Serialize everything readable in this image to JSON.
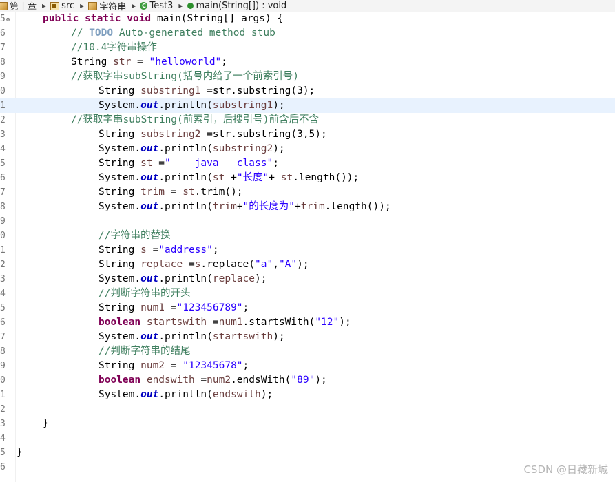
{
  "breadcrumb": {
    "items": [
      {
        "label": "第十章",
        "icon": "package-folder-icon"
      },
      {
        "label": "src",
        "icon": "source-folder-icon"
      },
      {
        "label": "字符串",
        "icon": "package-icon"
      },
      {
        "label": "Test3",
        "icon": "java-class-icon"
      },
      {
        "label": "main(String[]) : void",
        "icon": "public-method-icon"
      }
    ]
  },
  "editor": {
    "current_line": "1",
    "lines": [
      {
        "num": "5",
        "fold": "⊖",
        "tokens": [
          [
            "kw",
            "public static void "
          ],
          [
            "",
            "main(String[] args) {"
          ]
        ]
      },
      {
        "num": "6",
        "tokens": [
          [
            "cm",
            "// "
          ],
          [
            "todo",
            "TODO"
          ],
          [
            "cm",
            " Auto-generated method stub"
          ]
        ]
      },
      {
        "num": "7",
        "tokens": [
          [
            "cm",
            "//10.4字符串操作"
          ]
        ]
      },
      {
        "num": "8",
        "tokens": [
          [
            "",
            "String "
          ],
          [
            "var",
            "str"
          ],
          [
            "",
            " = "
          ],
          [
            "str",
            "\"helloworld\""
          ],
          [
            "",
            ";"
          ]
        ]
      },
      {
        "num": "9",
        "tokens": [
          [
            "cm",
            "//获取字串subString(括号内给了一个前索引号)"
          ]
        ]
      },
      {
        "num": "0",
        "tokens": [
          [
            "",
            "String "
          ],
          [
            "var",
            "substring1"
          ],
          [
            "",
            " =str.substring(3);"
          ]
        ]
      },
      {
        "num": "1",
        "tokens": [
          [
            "",
            "System."
          ],
          [
            "fld",
            "out"
          ],
          [
            "",
            ".println("
          ],
          [
            "var",
            "substring1"
          ],
          [
            "",
            ");"
          ]
        ]
      },
      {
        "num": "2",
        "tokens": [
          [
            "cm",
            "//获取字串subString(前索引，后搜引号)前含后不含"
          ]
        ]
      },
      {
        "num": "3",
        "tokens": [
          [
            "",
            "String "
          ],
          [
            "var",
            "substring2"
          ],
          [
            "",
            " =str.substring(3,5);"
          ]
        ]
      },
      {
        "num": "4",
        "tokens": [
          [
            "",
            "System."
          ],
          [
            "fld",
            "out"
          ],
          [
            "",
            ".println("
          ],
          [
            "var",
            "substring2"
          ],
          [
            "",
            ");"
          ]
        ]
      },
      {
        "num": "5",
        "tokens": [
          [
            "",
            "String "
          ],
          [
            "var",
            "st"
          ],
          [
            "",
            " ="
          ],
          [
            "str",
            "\"    java   class\""
          ],
          [
            "",
            ";"
          ]
        ]
      },
      {
        "num": "6",
        "tokens": [
          [
            "",
            "System."
          ],
          [
            "fld",
            "out"
          ],
          [
            "",
            ".println("
          ],
          [
            "var",
            "st"
          ],
          [
            "",
            " +"
          ],
          [
            "str",
            "\"长度\""
          ],
          [
            "",
            "+ "
          ],
          [
            "var",
            "st"
          ],
          [
            "",
            ".length());"
          ]
        ]
      },
      {
        "num": "7",
        "tokens": [
          [
            "",
            "String "
          ],
          [
            "var",
            "trim"
          ],
          [
            "",
            " = "
          ],
          [
            "var",
            "st"
          ],
          [
            "",
            ".trim();"
          ]
        ]
      },
      {
        "num": "8",
        "tokens": [
          [
            "",
            "System."
          ],
          [
            "fld",
            "out"
          ],
          [
            "",
            ".println("
          ],
          [
            "var",
            "trim"
          ],
          [
            "",
            "+"
          ],
          [
            "str",
            "\"的长度为\""
          ],
          [
            "",
            "+"
          ],
          [
            "var",
            "trim"
          ],
          [
            "",
            ".length());"
          ]
        ]
      },
      {
        "num": "9",
        "tokens": []
      },
      {
        "num": "0",
        "tokens": [
          [
            "cm",
            "//字符串的替换"
          ]
        ]
      },
      {
        "num": "1",
        "tokens": [
          [
            "",
            "String "
          ],
          [
            "var",
            "s"
          ],
          [
            "",
            " ="
          ],
          [
            "str",
            "\"address\""
          ],
          [
            "",
            ";"
          ]
        ]
      },
      {
        "num": "2",
        "tokens": [
          [
            "",
            "String "
          ],
          [
            "var",
            "replace"
          ],
          [
            "",
            " ="
          ],
          [
            "var",
            "s"
          ],
          [
            "",
            ".replace("
          ],
          [
            "str",
            "\"a\""
          ],
          [
            "",
            ","
          ],
          [
            "str",
            "\"A\""
          ],
          [
            "",
            ");"
          ]
        ]
      },
      {
        "num": "3",
        "tokens": [
          [
            "",
            "System."
          ],
          [
            "fld",
            "out"
          ],
          [
            "",
            ".println("
          ],
          [
            "var",
            "replace"
          ],
          [
            "",
            ");"
          ]
        ]
      },
      {
        "num": "4",
        "tokens": [
          [
            "cm",
            "//判断字符串的开头"
          ]
        ]
      },
      {
        "num": "5",
        "tokens": [
          [
            "",
            "String "
          ],
          [
            "var",
            "num1"
          ],
          [
            "",
            " ="
          ],
          [
            "str",
            "\"123456789\""
          ],
          [
            "",
            ";"
          ]
        ]
      },
      {
        "num": "6",
        "tokens": [
          [
            "kw",
            "boolean "
          ],
          [
            "var",
            "startswith"
          ],
          [
            "",
            " ="
          ],
          [
            "var",
            "num1"
          ],
          [
            "",
            ".startsWith("
          ],
          [
            "str",
            "\"12\""
          ],
          [
            "",
            ");"
          ]
        ]
      },
      {
        "num": "7",
        "tokens": [
          [
            "",
            "System."
          ],
          [
            "fld",
            "out"
          ],
          [
            "",
            ".println("
          ],
          [
            "var",
            "startswith"
          ],
          [
            "",
            ");"
          ]
        ]
      },
      {
        "num": "8",
        "tokens": [
          [
            "cm",
            "//判断字符串的结尾"
          ]
        ]
      },
      {
        "num": "9",
        "tokens": [
          [
            "",
            "String "
          ],
          [
            "var",
            "num2"
          ],
          [
            "",
            " = "
          ],
          [
            "str",
            "\"12345678\""
          ],
          [
            "",
            ";"
          ]
        ]
      },
      {
        "num": "0",
        "tokens": [
          [
            "kw",
            "boolean "
          ],
          [
            "var",
            "endswith"
          ],
          [
            "",
            " ="
          ],
          [
            "var",
            "num2"
          ],
          [
            "",
            ".endsWith("
          ],
          [
            "str",
            "\"89\""
          ],
          [
            "",
            ");"
          ]
        ]
      },
      {
        "num": "1",
        "tokens": [
          [
            "",
            "System."
          ],
          [
            "fld",
            "out"
          ],
          [
            "",
            ".println("
          ],
          [
            "var",
            "endswith"
          ],
          [
            "",
            ");"
          ]
        ]
      },
      {
        "num": "2",
        "tokens": []
      },
      {
        "num": "3",
        "tokens": [
          [
            "",
            "}"
          ]
        ]
      },
      {
        "num": "4",
        "tokens": []
      },
      {
        "num": "5",
        "tokens": [
          [
            "",
            "}"
          ]
        ]
      },
      {
        "num": "6",
        "tokens": []
      }
    ]
  },
  "watermark": "CSDN @日藏新城",
  "colors": {
    "keyword": "#7f0055",
    "comment": "#3f7f5f",
    "string": "#2a00ff",
    "field": "#0000c0",
    "variable": "#6a3e3e",
    "current_line": "#e8f2fe"
  }
}
